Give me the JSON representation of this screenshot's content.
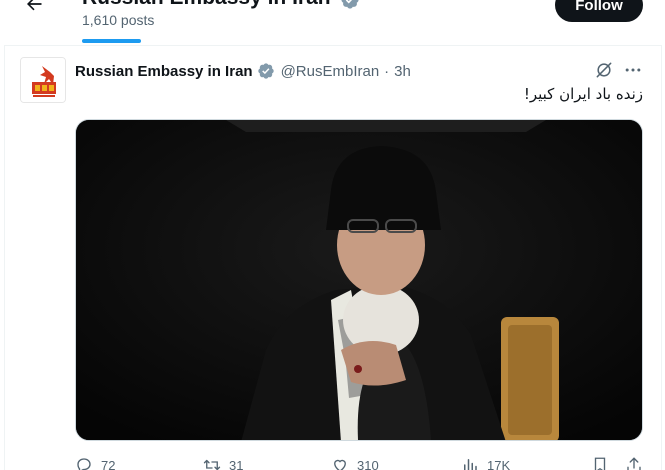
{
  "header": {
    "title": "Russian Embassy in Iran",
    "post_count": "1,610 posts",
    "follow_label": "Follow"
  },
  "tweet": {
    "author_name": "Russian Embassy in Iran",
    "handle": "@RusEmbIran",
    "separator": "·",
    "time": "3h",
    "text": "زنده باد ایران کبیر!",
    "stats": {
      "replies": "72",
      "reposts": "31",
      "likes": "310",
      "views": "17K"
    }
  },
  "icons": {
    "back": "arrow-left-icon",
    "verified": "verified-badge-icon",
    "grok": "grok-icon",
    "more": "more-horizontal-icon",
    "reply": "reply-icon",
    "repost": "repost-icon",
    "like": "heart-icon",
    "views": "views-bar-chart-icon",
    "bookmark": "bookmark-icon",
    "share": "share-icon"
  },
  "colors": {
    "accent": "#1d9bf0",
    "text": "#0f1419",
    "muted": "#536471",
    "verified_gray": "#829aab",
    "follow_bg": "#0f1419"
  }
}
